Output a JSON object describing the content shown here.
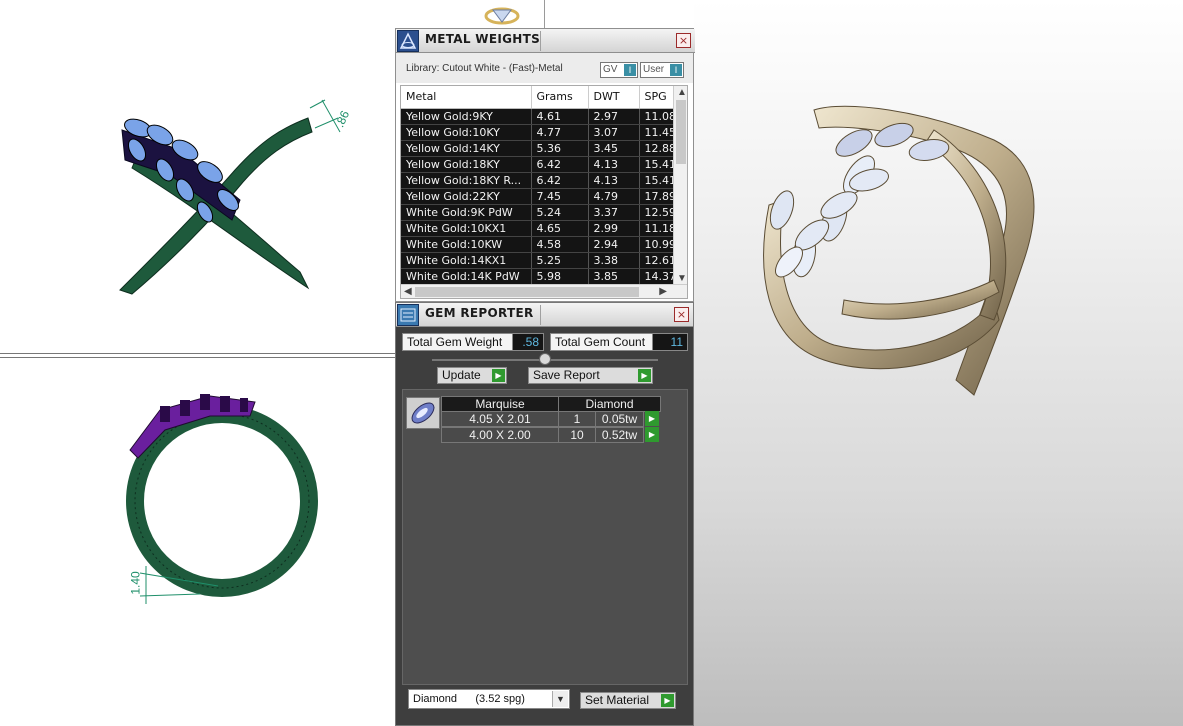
{
  "metal_weights": {
    "title": "METAL WEIGHTS",
    "close": "×",
    "library": "Library: Cutout White - (Fast)-Metal",
    "gv_label": "GV",
    "user_label": "User",
    "toggle_glyph": "I",
    "columns": [
      "Metal",
      "Grams",
      "DWT",
      "SPG"
    ],
    "rows": [
      [
        "Yellow Gold:9KY",
        "4.61",
        "2.97",
        "11.08"
      ],
      [
        "Yellow Gold:10KY",
        "4.77",
        "3.07",
        "11.45"
      ],
      [
        "Yellow Gold:14KY",
        "5.36",
        "3.45",
        "12.88"
      ],
      [
        "Yellow Gold:18KY",
        "6.42",
        "4.13",
        "15.41"
      ],
      [
        "Yellow Gold:18KY R...",
        "6.42",
        "4.13",
        "15.41"
      ],
      [
        "Yellow Gold:22KY",
        "7.45",
        "4.79",
        "17.89"
      ],
      [
        "White Gold:9K PdW",
        "5.24",
        "3.37",
        "12.59"
      ],
      [
        "White Gold:10KX1",
        "4.65",
        "2.99",
        "11.18"
      ],
      [
        "White Gold:10KW",
        "4.58",
        "2.94",
        "10.99"
      ],
      [
        "White Gold:14KX1",
        "5.25",
        "3.38",
        "12.61"
      ],
      [
        "White Gold:14K PdW",
        "5.98",
        "3.85",
        "14.37"
      ]
    ]
  },
  "gem_reporter": {
    "title": "GEM REPORTER",
    "close": "×",
    "total_weight_label": "Total Gem Weight",
    "total_weight_value": ".58",
    "total_count_label": "Total Gem Count",
    "total_count_value": "11",
    "update_label": "Update",
    "save_label": "Save Report",
    "shape_header": "Marquise",
    "type_header": "Diamond",
    "gems": [
      {
        "size": "4.05 X 2.01",
        "count": "1",
        "weight": "0.05tw"
      },
      {
        "size": "4.00 X 2.00",
        "count": "10",
        "weight": "0.52tw"
      }
    ],
    "material_select": "Diamond      (3.52 spg)",
    "set_material_label": "Set Material"
  },
  "dimensions": {
    "top_view": ".86",
    "front_view": "1.40"
  },
  "colors": {
    "band_green": "#1e5a3c",
    "gem_blue": "#7aa3e8",
    "metal_gold": "#bfae8c"
  }
}
